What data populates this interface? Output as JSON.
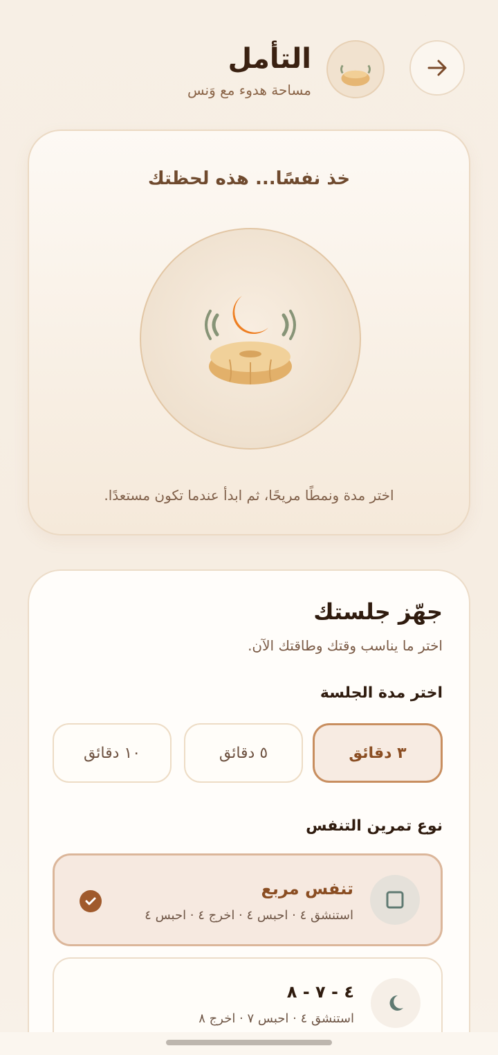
{
  "header": {
    "title": "التأمل",
    "subtitle": "مساحة هدوء مع وَنس",
    "back_icon": "arrow-right-icon",
    "avatar_icon": "meditation-cushion-moon-icon"
  },
  "hero": {
    "heading": "خذ نفسًا... هذه لحظتك",
    "illustration": "meditation-cushion-moon-icon",
    "hint": "اختر مدة ونمطًا مريحًا، ثم ابدأ عندما تكون مستعدًا."
  },
  "session": {
    "title": "جهّز جلستك",
    "subtitle": "اختر ما يناسب وقتك وطاقتك الآن.",
    "duration_label": "اختر مدة الجلسة",
    "durations": [
      {
        "label": "٣ دقائق",
        "selected": true
      },
      {
        "label": "٥ دقائق",
        "selected": false
      },
      {
        "label": "١٠ دقائق",
        "selected": false
      }
    ],
    "breathing_label": "نوع تمرين التنفس",
    "breathing": [
      {
        "name": "تنفس مربع",
        "desc": "استنشق ٤ · احبس ٤ · اخرج ٤ · احبس ٤",
        "icon": "square-icon",
        "selected": true
      },
      {
        "name": "٤ - ٧ - ٨",
        "desc": "استنشق ٤ · احبس ٧ · اخرج ٨",
        "icon": "crescent-moon-icon",
        "selected": false
      }
    ]
  },
  "colors": {
    "accent": "#a05a2c",
    "background": "#f7efe5",
    "selected_border": "#c88e5f"
  }
}
